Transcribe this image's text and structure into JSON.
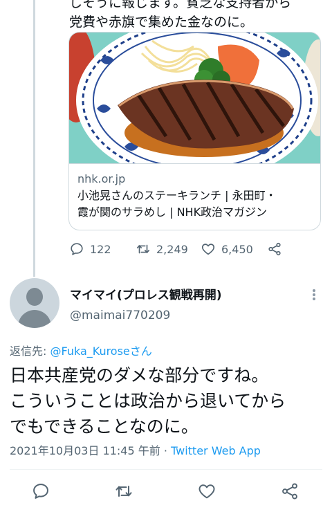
{
  "parent_tweet": {
    "text_lines": [
      "しそうに報じます。貧乏な支持者から",
      "党費や赤旗で集めた金なのに。"
    ],
    "card": {
      "domain": "nhk.or.jp",
      "title_line1": "小池晃さんのステーキランチ | 永田町・",
      "title_line2": "霞が関のサラめし | NHK政治マガジン",
      "image_subject": "steak-lunch-plate"
    },
    "actions": {
      "reply_count": "122",
      "retweet_count": "2,249",
      "like_count": "6,450"
    }
  },
  "reply_tweet": {
    "display_name": "マイマイ(プロレス観戦再開)",
    "handle": "@maimai770209",
    "reply_prefix": "返信先: ",
    "reply_mention": "@Fuka_Kuroseさん",
    "text_lines": [
      "日本共産党のダメな部分ですね。",
      "こういうことは政治から退いてから",
      "でもできることなのに。"
    ],
    "timestamp": "2021年10月03日 11:45 午前",
    "separator": " · ",
    "app": "Twitter Web App"
  },
  "colors": {
    "link_blue": "#1d9bf0",
    "secondary_text": "#536471",
    "thread_line": "#cfd9de"
  },
  "icons": [
    "reply-icon",
    "retweet-icon",
    "like-icon",
    "share-icon",
    "more-icon",
    "default-avatar-icon"
  ]
}
